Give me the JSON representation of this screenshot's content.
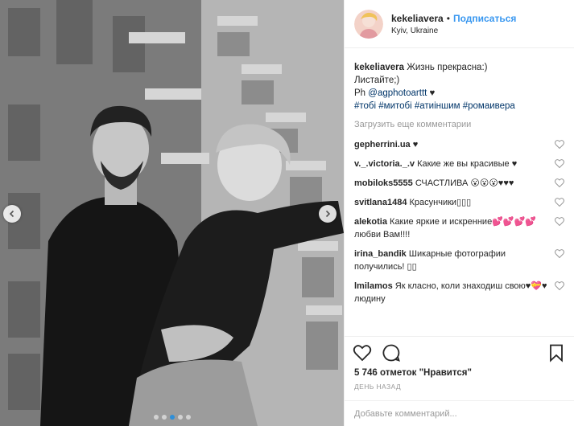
{
  "header": {
    "username": "kekeliavera",
    "separator": "•",
    "follow_label": "Подписаться",
    "location": "Kyiv, Ukraine"
  },
  "caption": {
    "author": "kekeliavera",
    "line1": "Жизнь прекрасна:)",
    "line2": "Листайте;)",
    "line3_prefix": "Ph",
    "mention": "@agphotoarttt",
    "line3_suffix": "♥",
    "hashtags": "#тобі #митобі #атиіншим #ромаивера"
  },
  "load_more_label": "Загрузить еще комментарии",
  "comments": [
    {
      "author": "gepherrini.ua",
      "text": "♥"
    },
    {
      "author": "v._.victoria._.v",
      "text": "Какие же вы красивые ♥"
    },
    {
      "author": "mobiloks5555",
      "text": "СЧАСТЛИВА 😮😮😮♥♥♥"
    },
    {
      "author": "svitlana1484",
      "text": "Красунчики▯▯▯"
    },
    {
      "author": "alekotia",
      "text": "Какие яркие и искренние💕💕💕💕 любви Вам!!!!"
    },
    {
      "author": "irina_bandik",
      "text": "Шикарные фотографии получились! ▯▯"
    },
    {
      "author": "lmilamos",
      "text": "Як класно, коли знаходиш свою♥💝♥ людину"
    }
  ],
  "likes": {
    "count_text": "5 746 отметок",
    "suffix": "\"Нравится\""
  },
  "time_label": "ДЕНЬ НАЗАД",
  "add_comment_placeholder": "Добавьте комментарий...",
  "carousel": {
    "slide_count": 5,
    "active_slide": 2
  },
  "icons": {
    "like": "heart-icon",
    "comment": "comment-icon",
    "share": "share-icon",
    "save": "bookmark-icon",
    "prev": "chevron-left-icon",
    "next": "chevron-right-icon"
  },
  "colors": {
    "link": "#3897f0",
    "muted": "#999999",
    "text": "#262626"
  }
}
